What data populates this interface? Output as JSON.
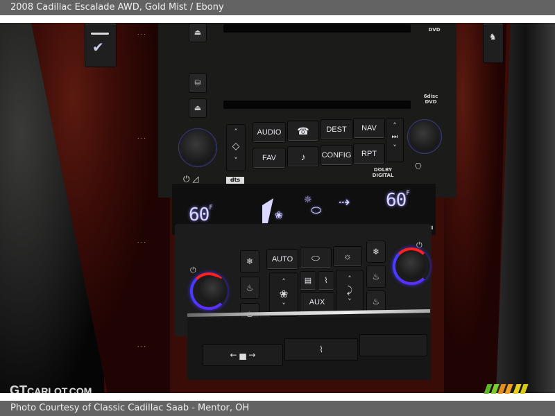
{
  "header": {
    "title": "2008 Cadillac Escalade AWD,  Gold Mist / Ebony"
  },
  "footer": {
    "credit": "Photo Courtesy of Classic Cadillac Saab - Mentor, OH"
  },
  "watermark": {
    "brand_big": "GT",
    "brand_small": "CARLOT.COM"
  },
  "photo": {
    "subject": "center stack: radio and climate controls",
    "side_controls": {
      "left_icon": "check-icon",
      "right_icon": "seat-belt-icon"
    },
    "radio": {
      "media_logos": [
        "DVD",
        "6disc DVD"
      ],
      "buttons_row1": [
        "AUDIO",
        "☎",
        "DEST",
        "NAV"
      ],
      "buttons_row2": [
        "FAV",
        "♪",
        "CONFIG",
        "RPT"
      ],
      "left_rocker": {
        "up": "˄",
        "mid": "◇",
        "down": "˅"
      },
      "right_rocker": {
        "up": "˄",
        "mid": "⏭",
        "down": "˅"
      },
      "dts_label": "dts",
      "dolby_label": "DOLBY",
      "digital_label": "DIGITAL",
      "power_volume_icon": "⏻ ◿",
      "eject_icon": "⏏",
      "disc_icon": "⛁",
      "aux_icon": "⎔"
    },
    "display": {
      "left_temp": "60",
      "right_temp": "60",
      "temp_unit": "F",
      "fan_level_fraction": 0.6,
      "fan_icon": "❀",
      "sun_icon": "☼",
      "vehicle_icon": "⬭",
      "airflow_icon": "⇢"
    },
    "climate": {
      "auto_label": "AUTO",
      "aux_label": "AUX",
      "recirc_icon": "⬭",
      "sun_icon": "☼",
      "fan_icon": "❀",
      "rear_defrost_icon": "▤",
      "front_defrost_icon": "⌇",
      "mode_icon": "⤸",
      "up_icon": "˄",
      "down_icon": "˅",
      "power_icon": "⏻",
      "seat_icons": [
        "❄",
        "♨",
        "♨"
      ]
    },
    "tray": {
      "pedal_adjust": "← ▅ →",
      "rear_defrost": "⌇"
    }
  }
}
